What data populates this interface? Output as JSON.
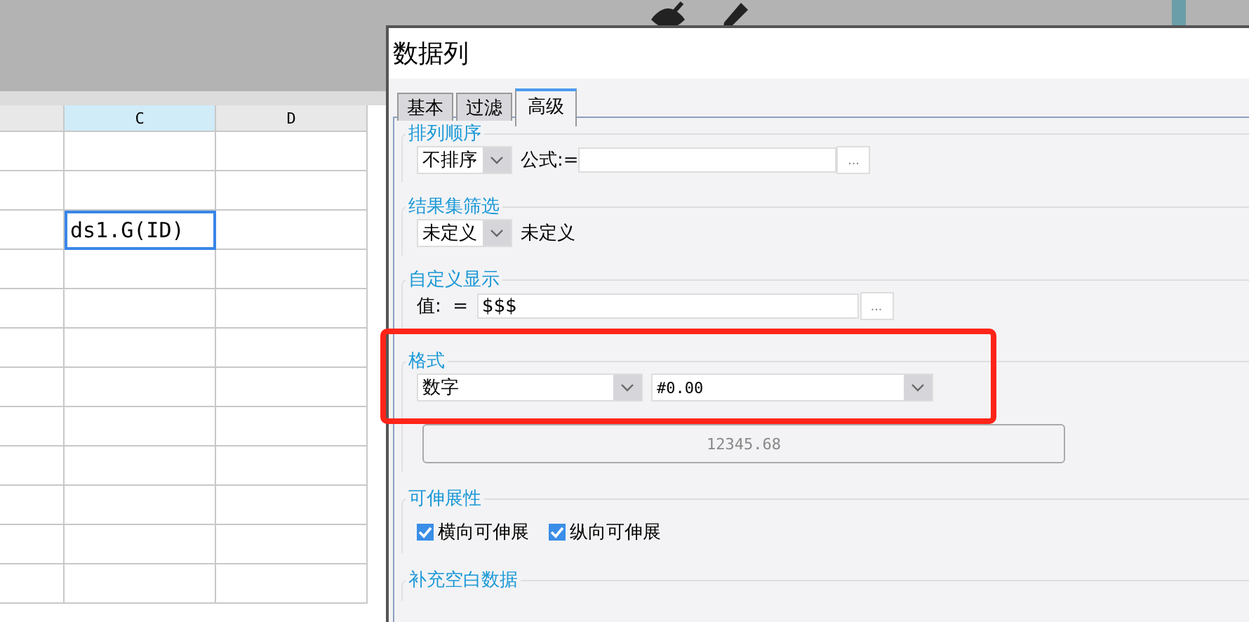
{
  "sheet": {
    "columns": [
      {
        "selected": false
      },
      {
        "label": "C",
        "selected": true
      },
      {
        "label": "D",
        "selected": false
      }
    ],
    "active_cell": {
      "value": "ds1.G(ID)"
    }
  },
  "dialog": {
    "title": "数据列",
    "tabs": [
      {
        "label": "基本",
        "selected": false
      },
      {
        "label": "过滤",
        "selected": false
      },
      {
        "label": "高级",
        "selected": true
      }
    ],
    "sort": {
      "legend": "排列顺序",
      "select": "不排序",
      "formula_label": "公式:=",
      "more": "..."
    },
    "filter": {
      "legend": "结果集筛选",
      "select": "未定义",
      "value": "未定义"
    },
    "display": {
      "legend": "自定义显示",
      "label": "值:  =",
      "value": "$$$",
      "more": "..."
    },
    "format": {
      "legend": "格式",
      "type": "数字",
      "pattern": "#0.00",
      "example": "12345.68"
    },
    "expand": {
      "legend": "可伸展性",
      "options": [
        {
          "label": "横向可伸展",
          "checked": true
        },
        {
          "label": "纵向可伸展",
          "checked": true
        }
      ]
    },
    "fill": {
      "legend": "补充空白数据"
    }
  }
}
